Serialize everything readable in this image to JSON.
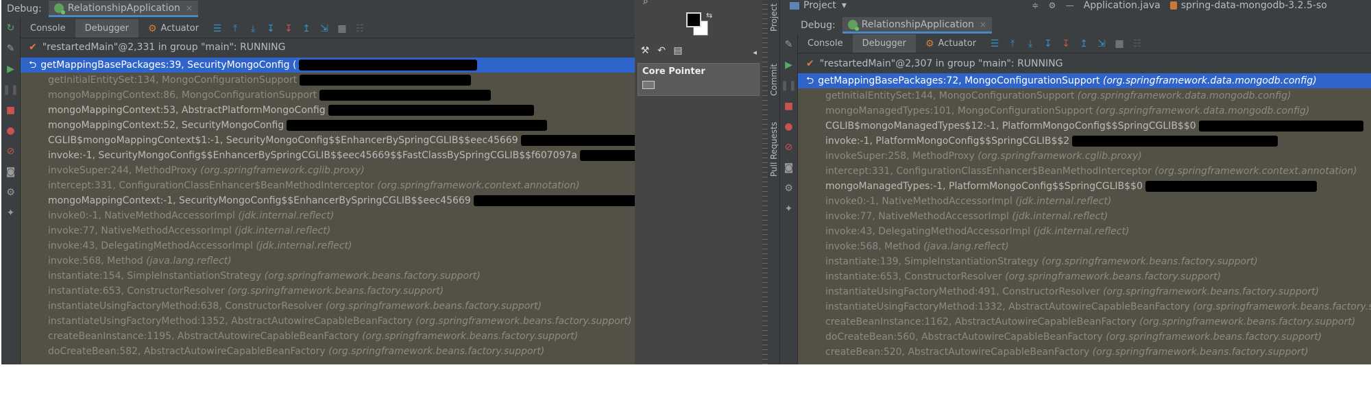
{
  "left": {
    "debug_label": "Debug:",
    "run_tab": "RelationshipApplication",
    "toolbar": {
      "console": "Console",
      "debugger": "Debugger",
      "actuator": "Actuator"
    },
    "thread": "\"restartedMain\"@2,331 in group \"main\": RUNNING",
    "frames": [
      {
        "method": "getMappingBasePackages:39, SecurityMongoConfig (",
        "pkg": "",
        "style": "selected"
      },
      {
        "method": "getInitialEntitySet:134, MongoConfigurationSupport",
        "pkg": "",
        "style": "lib"
      },
      {
        "method": "mongoMappingContext:86, MongoConfigurationSupport",
        "pkg": "",
        "style": "lib"
      },
      {
        "method": "mongoMappingContext:53, AbstractPlatformMongoConfig",
        "pkg": "",
        "style": "app"
      },
      {
        "method": "mongoMappingContext:52, SecurityMongoConfig",
        "pkg": "",
        "style": "app"
      },
      {
        "method": "CGLIB$mongoMappingContext$1:-1, SecurityMongoConfig$$EnhancerBySpringCGLIB$$eec45669",
        "pkg": "",
        "style": "app"
      },
      {
        "method": "invoke:-1, SecurityMongoConfig$$EnhancerBySpringCGLIB$$eec45669$$FastClassBySpringCGLIB$$f607097a",
        "pkg": "",
        "style": "app"
      },
      {
        "method": "invokeSuper:244, MethodProxy",
        "pkg": "(org.springframework.cglib.proxy)",
        "style": "lib"
      },
      {
        "method": "intercept:331, ConfigurationClassEnhancer$BeanMethodInterceptor",
        "pkg": "(org.springframework.context.annotation)",
        "style": "lib"
      },
      {
        "method": "mongoMappingContext:-1, SecurityMongoConfig$$EnhancerBySpringCGLIB$$eec45669",
        "pkg": "",
        "style": "app"
      },
      {
        "method": "invoke0:-1, NativeMethodAccessorImpl",
        "pkg": "(jdk.internal.reflect)",
        "style": "lib"
      },
      {
        "method": "invoke:77, NativeMethodAccessorImpl",
        "pkg": "(jdk.internal.reflect)",
        "style": "lib"
      },
      {
        "method": "invoke:43, DelegatingMethodAccessorImpl",
        "pkg": "(jdk.internal.reflect)",
        "style": "lib"
      },
      {
        "method": "invoke:568, Method",
        "pkg": "(java.lang.reflect)",
        "style": "lib"
      },
      {
        "method": "instantiate:154, SimpleInstantiationStrategy",
        "pkg": "(org.springframework.beans.factory.support)",
        "style": "lib"
      },
      {
        "method": "instantiate:653, ConstructorResolver",
        "pkg": "(org.springframework.beans.factory.support)",
        "style": "lib"
      },
      {
        "method": "instantiateUsingFactoryMethod:638, ConstructorResolver",
        "pkg": "(org.springframework.beans.factory.support)",
        "style": "lib"
      },
      {
        "method": "instantiateUsingFactoryMethod:1352, AbstractAutowireCapableBeanFactory",
        "pkg": "(org.springframework.beans.factory.support)",
        "style": "lib"
      },
      {
        "method": "createBeanInstance:1195, AbstractAutowireCapableBeanFactory",
        "pkg": "(org.springframework.beans.factory.support)",
        "style": "lib"
      },
      {
        "method": "doCreateBean:582, AbstractAutowireCapableBeanFactory",
        "pkg": "(org.springframework.beans.factory.support)",
        "style": "lib"
      }
    ]
  },
  "gimp": {
    "core_pointer": "Core Pointer"
  },
  "right": {
    "project_label": "Project",
    "file_tab_1": "Application.java",
    "file_tab_2": "spring-data-mongodb-3.2.5-so",
    "side_tab_project": "Project",
    "side_tab_commit": "Commit",
    "side_tab_pull": "Pull Requests",
    "debug_label": "Debug:",
    "run_tab": "RelationshipApplication",
    "toolbar": {
      "console": "Console",
      "debugger": "Debugger",
      "actuator": "Actuator"
    },
    "thread": "\"restartedMain\"@2,307 in group \"main\": RUNNING",
    "frames": [
      {
        "method": "getMappingBasePackages:72, MongoConfigurationSupport",
        "pkg": "(org.springframework.data.mongodb.config)",
        "style": "selected"
      },
      {
        "method": "getInitialEntitySet:144, MongoConfigurationSupport",
        "pkg": "(org.springframework.data.mongodb.config)",
        "style": "lib"
      },
      {
        "method": "mongoManagedTypes:101, MongoConfigurationSupport",
        "pkg": "(org.springframework.data.mongodb.config)",
        "style": "lib"
      },
      {
        "method": "CGLIB$mongoManagedTypes$12:-1, PlatformMongoConfig$$SpringCGLIB$$0",
        "pkg": "",
        "style": "app"
      },
      {
        "method": "invoke:-1, PlatformMongoConfig$$SpringCGLIB$$2",
        "pkg": "",
        "style": "app"
      },
      {
        "method": "invokeSuper:258, MethodProxy",
        "pkg": "(org.springframework.cglib.proxy)",
        "style": "lib"
      },
      {
        "method": "intercept:331, ConfigurationClassEnhancer$BeanMethodInterceptor",
        "pkg": "(org.springframework.context.annotation)",
        "style": "lib"
      },
      {
        "method": "mongoManagedTypes:-1, PlatformMongoConfig$$SpringCGLIB$$0",
        "pkg": "",
        "style": "app"
      },
      {
        "method": "invoke0:-1, NativeMethodAccessorImpl",
        "pkg": "(jdk.internal.reflect)",
        "style": "lib"
      },
      {
        "method": "invoke:77, NativeMethodAccessorImpl",
        "pkg": "(jdk.internal.reflect)",
        "style": "lib"
      },
      {
        "method": "invoke:43, DelegatingMethodAccessorImpl",
        "pkg": "(jdk.internal.reflect)",
        "style": "lib"
      },
      {
        "method": "invoke:568, Method",
        "pkg": "(java.lang.reflect)",
        "style": "lib"
      },
      {
        "method": "instantiate:139, SimpleInstantiationStrategy",
        "pkg": "(org.springframework.beans.factory.support)",
        "style": "lib"
      },
      {
        "method": "instantiate:653, ConstructorResolver",
        "pkg": "(org.springframework.beans.factory.support)",
        "style": "lib"
      },
      {
        "method": "instantiateUsingFactoryMethod:491, ConstructorResolver",
        "pkg": "(org.springframework.beans.factory.support)",
        "style": "lib"
      },
      {
        "method": "instantiateUsingFactoryMethod:1332, AbstractAutowireCapableBeanFactory",
        "pkg": "(org.springframework.beans.factory.su",
        "style": "lib"
      },
      {
        "method": "createBeanInstance:1162, AbstractAutowireCapableBeanFactory",
        "pkg": "(org.springframework.beans.factory.support)",
        "style": "lib"
      },
      {
        "method": "doCreateBean:560, AbstractAutowireCapableBeanFactory",
        "pkg": "(org.springframework.beans.factory.support)",
        "style": "lib"
      },
      {
        "method": "createBean:520, AbstractAutowireCapableBeanFactory",
        "pkg": "(org.springframework.beans.factory.support)",
        "style": "lib"
      }
    ]
  }
}
